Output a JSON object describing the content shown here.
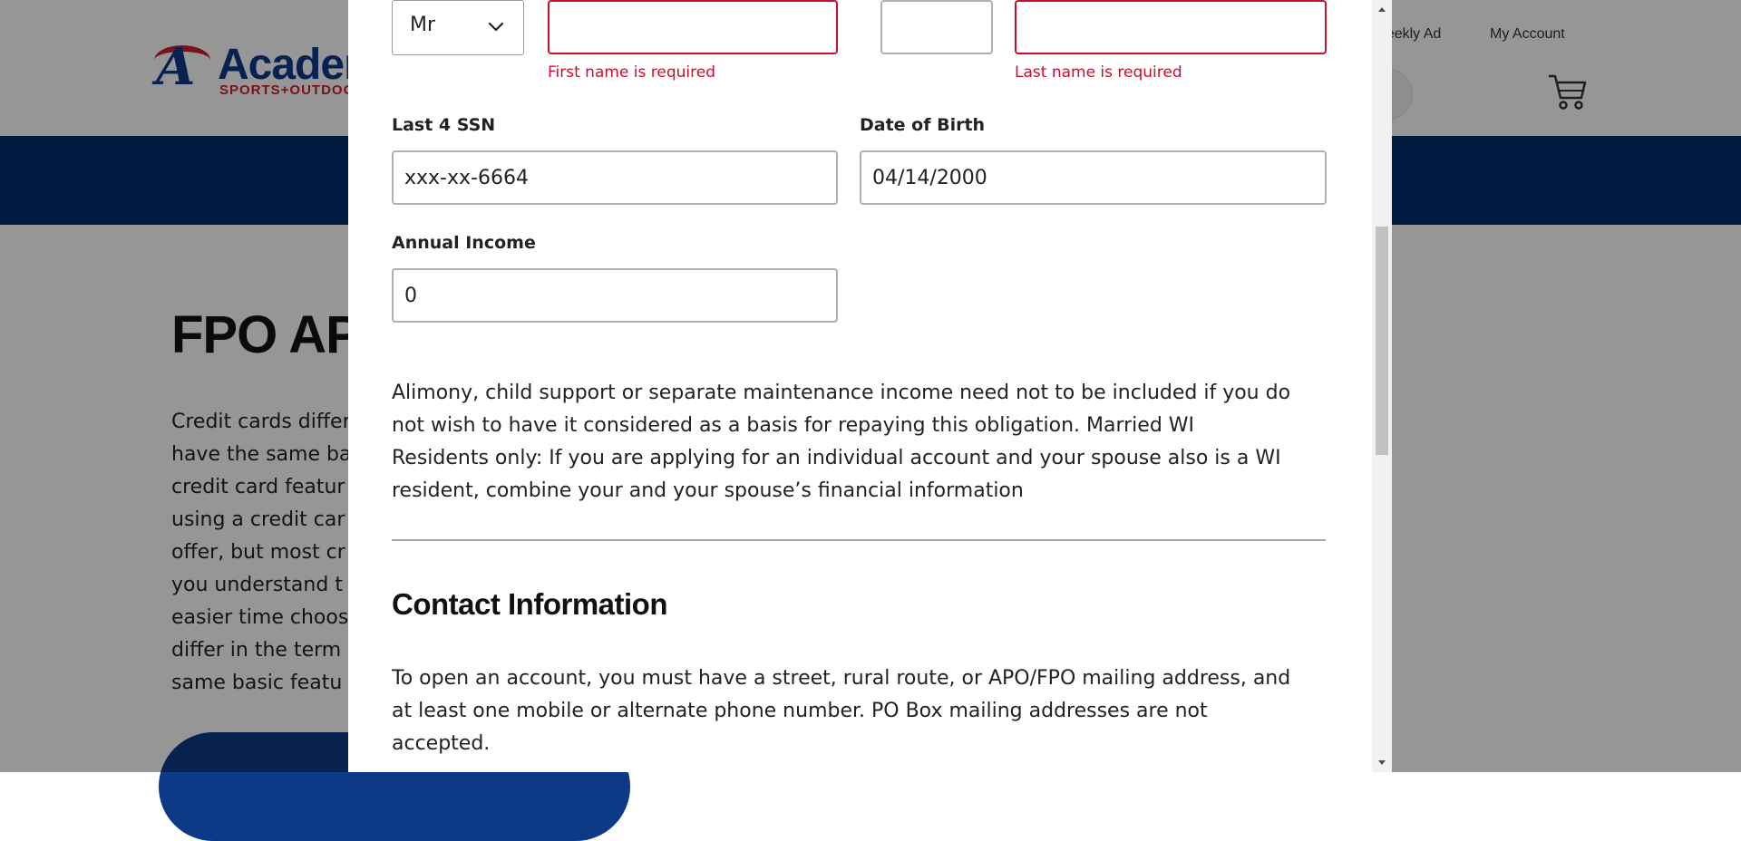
{
  "background": {
    "logo": {
      "word": "Academy",
      "sub": "SPORTS+OUTDOORS"
    },
    "header_links": {
      "weekly_ad": "Weekly Ad",
      "my_account": "My Account"
    },
    "page_title": "FPO APPLICATION",
    "body_lines": [
      "Credit cards differ",
      "have the same ba",
      "credit card featur",
      "using a credit car",
      "offer, but most cr",
      "you understand t",
      "easier time choos",
      "differ in the term",
      "same basic featu"
    ]
  },
  "form": {
    "title_select": {
      "value": "Mr"
    },
    "first_name": {
      "value": "",
      "error": "First name is required"
    },
    "middle_initial": {
      "value": ""
    },
    "last_name": {
      "value": "",
      "error": "Last name is required"
    },
    "ssn": {
      "label": "Last 4 SSN",
      "value": "xxx-xx-6664"
    },
    "dob": {
      "label": "Date of Birth",
      "value": "04/14/2000"
    },
    "income": {
      "label": "Annual Income",
      "value": "0"
    },
    "alimony_lines": [
      "Alimony, child support or separate maintenance income need not to be included if you do",
      "not wish to have it  considered as a basis for repaying this obligation. Married WI",
      "Residents only: If you are applying for an individual account and your spouse also is a WI",
      "resident,  combine your and your spouse’s financial information"
    ]
  },
  "contact": {
    "title": "Contact Information",
    "lines": [
      "To open an account, you must have a street, rural route, or APO/FPO mailing address, and",
      "at least one mobile or alternate phone number. PO Box mailing addresses are not",
      "accepted."
    ]
  },
  "colors": {
    "error": "#c8102e",
    "brand_blue": "#002f6c",
    "overlay": "rgba(0,0,0,0.41)"
  },
  "icons": [
    "chevron-down-icon",
    "cart-icon",
    "search-icon",
    "scroll-up-icon",
    "scroll-down-icon"
  ]
}
